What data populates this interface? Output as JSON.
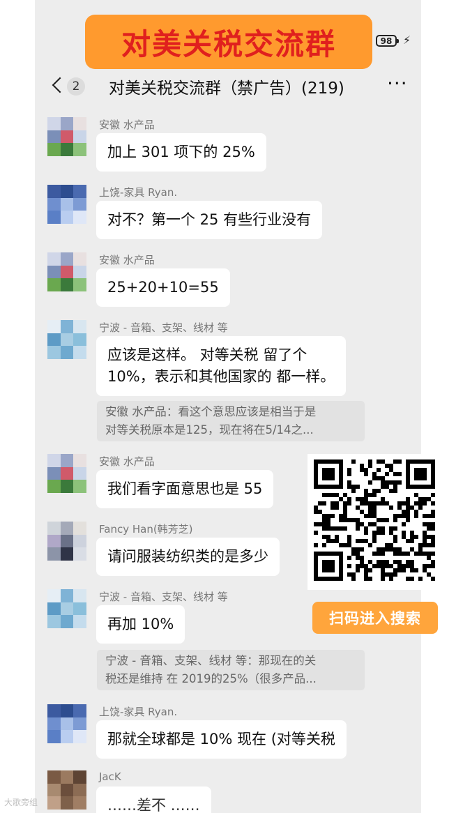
{
  "banner": {
    "title": "对美关税交流群"
  },
  "status_bar": {
    "battery": "98"
  },
  "header": {
    "unread": "2",
    "title": "对美关税交流群（禁广告）(219)",
    "more": "···"
  },
  "messages": [
    {
      "sender": "安徽 水产品",
      "text": "加上 301 项下的 25%"
    },
    {
      "sender": "上饶-家具 Ryan.",
      "text": "对不？第一个 25 有些行业没有"
    },
    {
      "sender": "安徽 水产品",
      "text": "25+20+10=55"
    },
    {
      "sender": "宁波 - 音箱、支架、线材 等",
      "line1": "应该是这样。 对等关税 留了个",
      "line2": "10%，表示和其他国家的 都一样。"
    },
    {
      "sender": "安徽 水产品",
      "text": "我们看字面意思也是 55"
    },
    {
      "sender": "Fancy Han(韩芳芝)",
      "text": "请问服装纺织类的是多少"
    },
    {
      "sender": "宁波 - 音箱、支架、线材 等",
      "text": "再加 10%"
    },
    {
      "sender": "上饶-家具 Ryan.",
      "text": "那就全球都是 10% 现在 (对等关税"
    },
    {
      "sender": "JacK",
      "text": "……差不 ……"
    }
  ],
  "quotes": [
    {
      "line1": "安徽 水产品：看这个意思应该是相当于是",
      "line2": "对等关税原本是125，现在将在5/14之..."
    },
    {
      "line1": "宁波 - 音箱、支架、线材 等：那现在的关",
      "line2": "税还是维持 在 2019的25%（很多产品..."
    }
  ],
  "promo": {
    "scan_label": "扫码进入搜索"
  },
  "watermark": "大歌旁组",
  "colors": {
    "accent_orange": "#ff9a2e",
    "banner_text": "#e0201e",
    "chat_bg": "#ededed"
  }
}
